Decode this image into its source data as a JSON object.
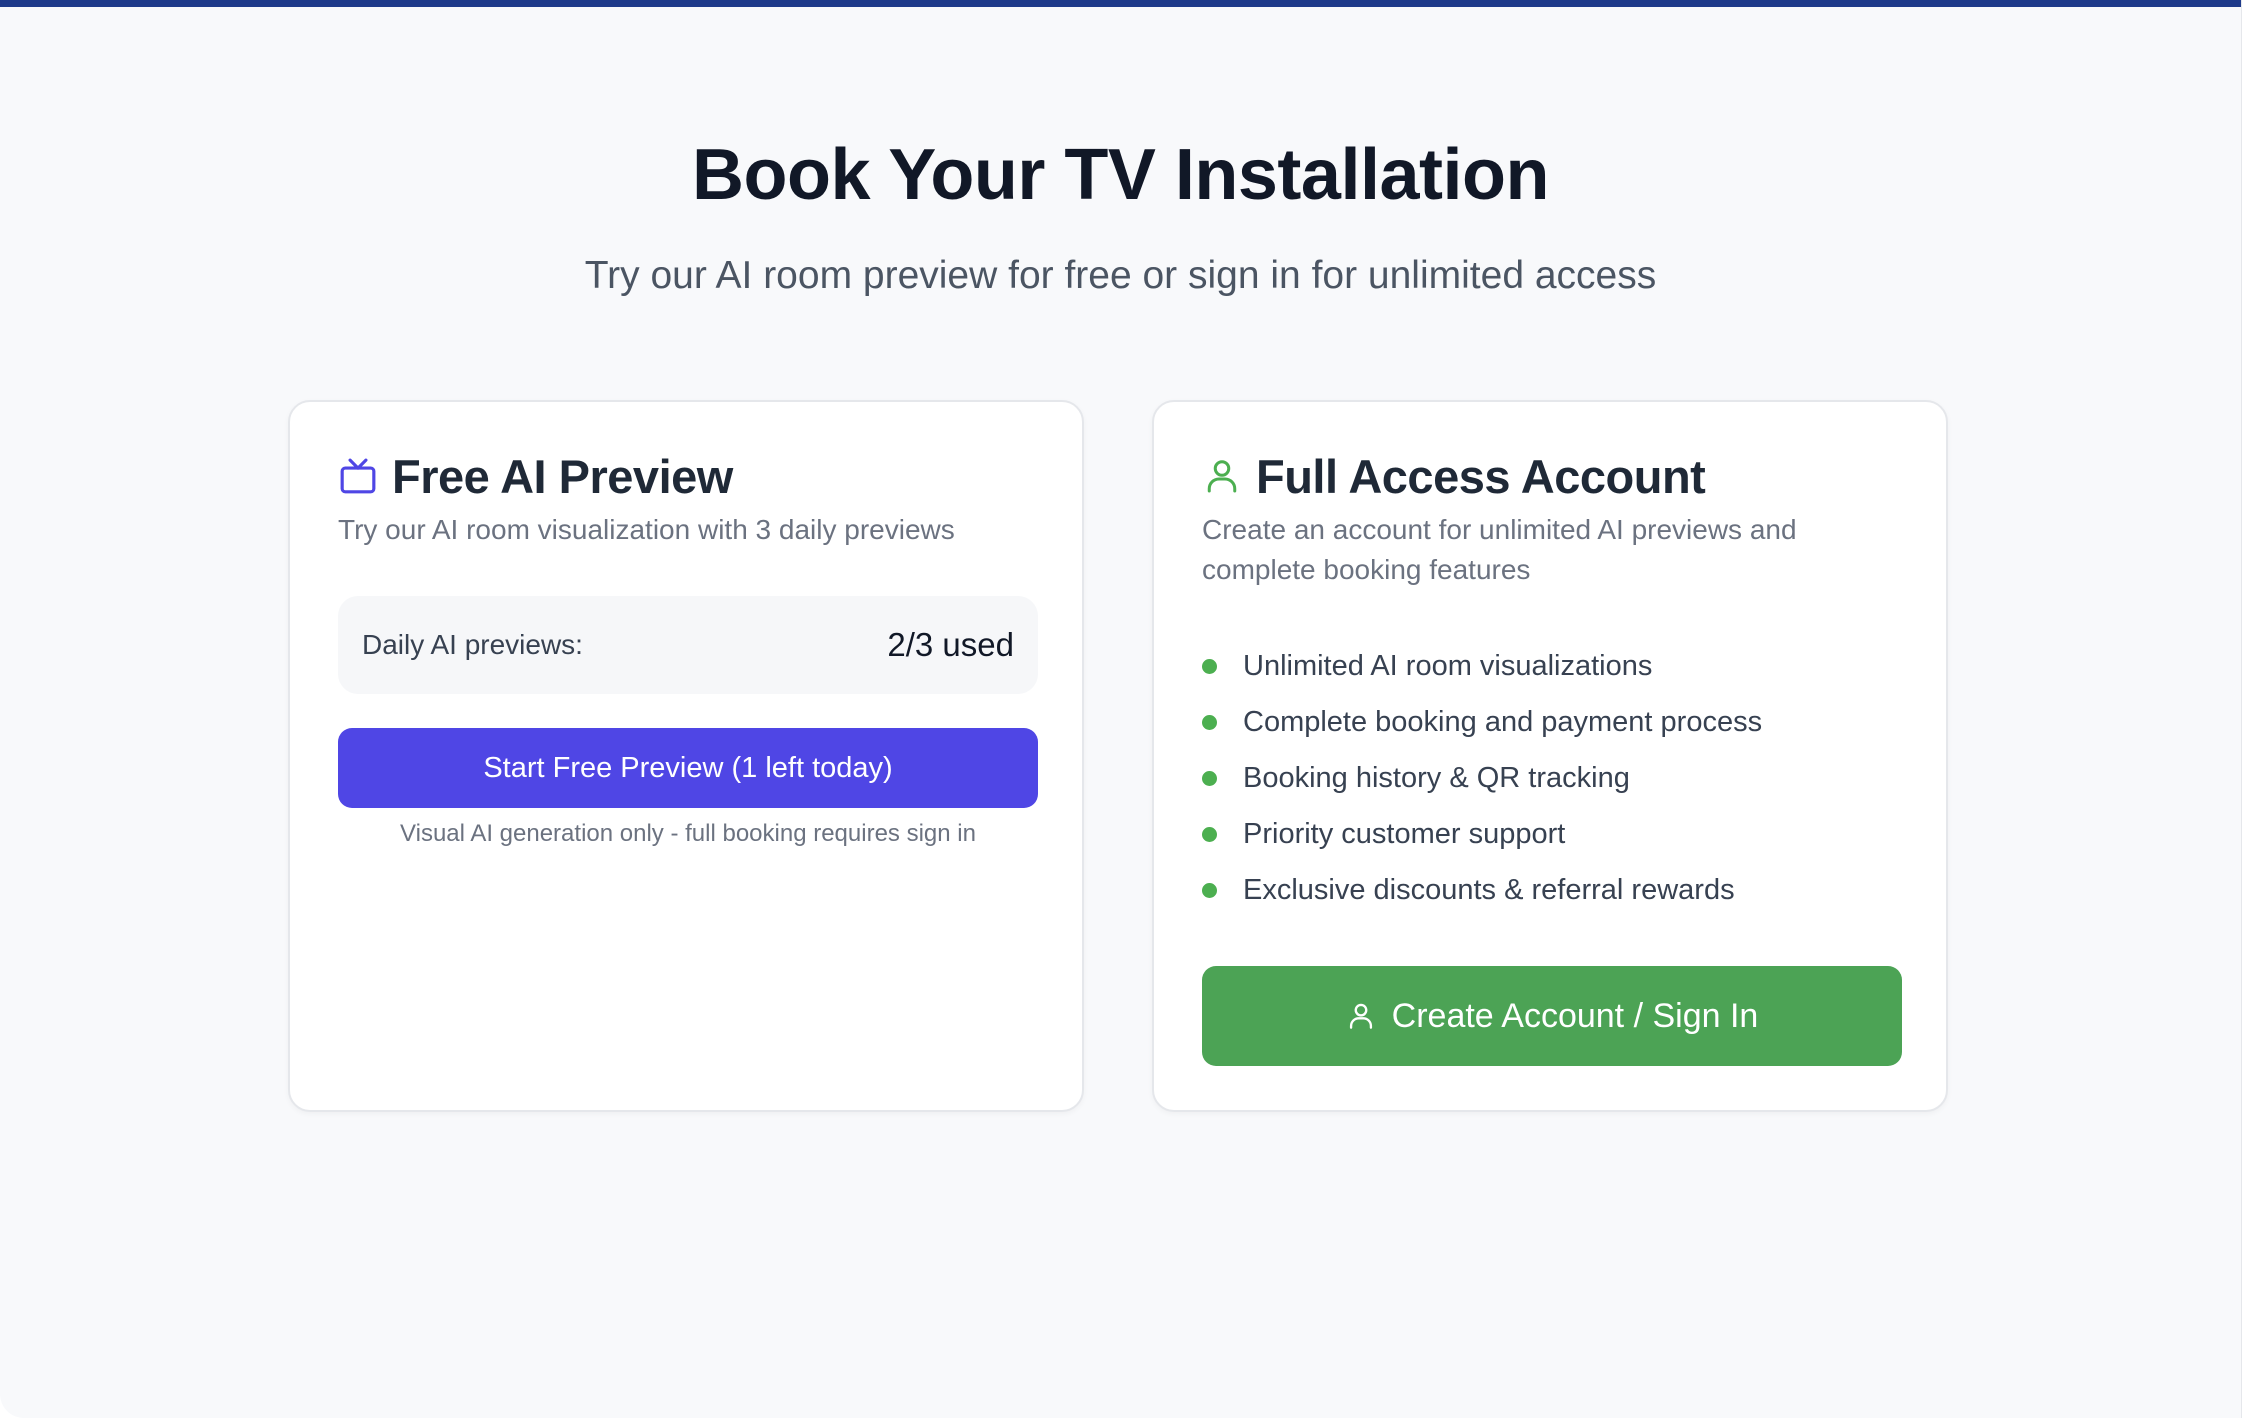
{
  "header": {
    "title": "Book Your TV Installation",
    "subtitle": "Try our AI room preview for free or sign in for unlimited access"
  },
  "free_preview": {
    "icon": "tv-icon",
    "title": "Free AI Preview",
    "description": "Try our AI room visualization with 3 daily previews",
    "usage_label": "Daily AI previews:",
    "usage_value": "2/3 used",
    "button_label": "Start Free Preview (1 left today)",
    "note": "Visual AI generation only - full booking requires sign in",
    "accent_color": "#4f46e5"
  },
  "full_access": {
    "icon": "user-icon",
    "title": "Full Access Account",
    "description": "Create an account for unlimited AI previews and complete booking features",
    "features": [
      "Unlimited AI room visualizations",
      "Complete booking and payment process",
      "Booking history & QR tracking",
      "Priority customer support",
      "Exclusive discounts & referral rewards"
    ],
    "button_label": "Create Account / Sign In",
    "accent_color": "#4ca355"
  }
}
